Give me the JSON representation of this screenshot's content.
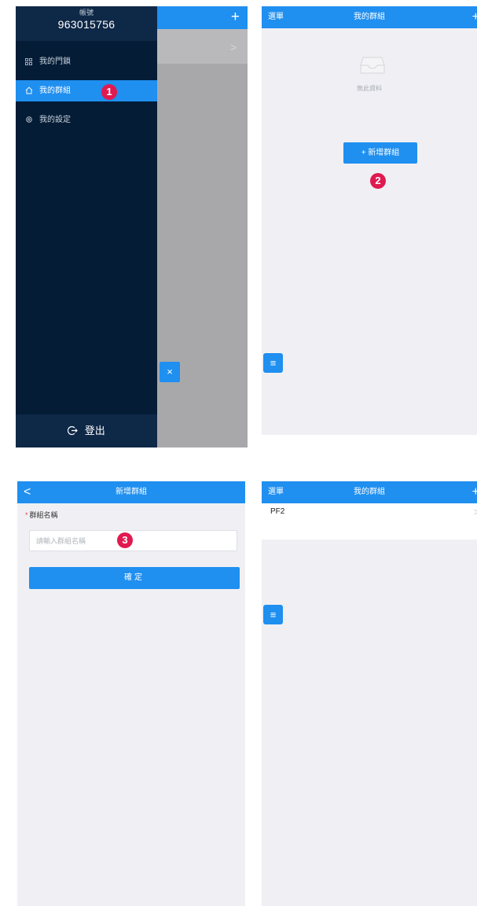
{
  "panel1": {
    "account_label": "帳號",
    "account_number": "963015756",
    "menu": [
      {
        "label": "我的門鎖",
        "icon": "grid-icon",
        "active": false
      },
      {
        "label": "我的群組",
        "icon": "home-icon",
        "active": true
      },
      {
        "label": "我的設定",
        "icon": "gear-icon",
        "active": false
      }
    ],
    "logout_label": "登出",
    "background_plus": "+",
    "close_symbol": "×",
    "step_badge": "1"
  },
  "panel2": {
    "menu_label": "選單",
    "title": "我的群組",
    "empty_text": "無此資料",
    "add_button_label": "+ 新增群組",
    "fab_symbol": "≡",
    "step_badge": "2"
  },
  "panel3": {
    "back_symbol": "<",
    "title": "新增群組",
    "required_mark": "*",
    "field_label": "群組名稱",
    "input_placeholder": "請輸入群組名稱",
    "input_value": "",
    "confirm_label": "確定",
    "step_badge": "3"
  },
  "panel4": {
    "menu_label": "選單",
    "title": "我的群組",
    "group_items": [
      {
        "name": "PF2"
      }
    ],
    "fab_symbol": "≡"
  },
  "colors": {
    "accent": "#1f8ff0",
    "drawer_bg": "#041c35",
    "badge": "#e01a50",
    "page_bg": "#f0f0f4"
  }
}
